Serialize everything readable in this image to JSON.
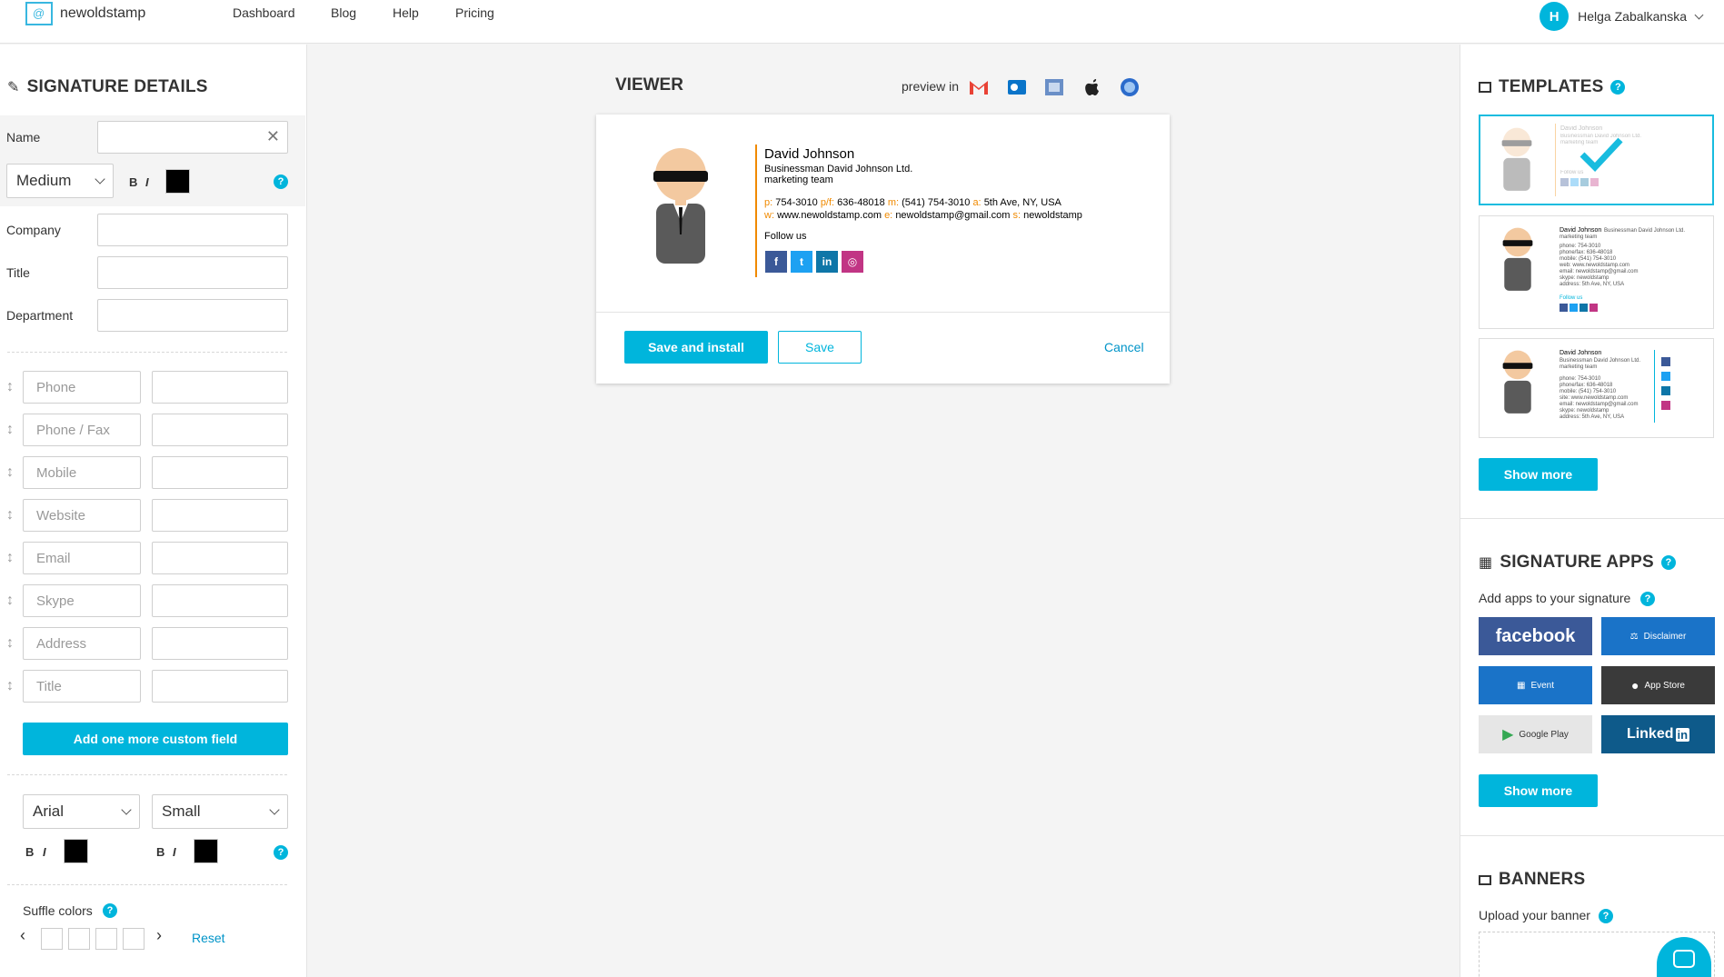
{
  "nav": {
    "logo_text": "newoldstamp",
    "links": [
      "Dashboard",
      "Blog",
      "Help",
      "Pricing"
    ],
    "user_initial": "H",
    "user_name": "Helga Zabalkanska"
  },
  "details": {
    "title": "SIGNATURE DETAILS",
    "name_label": "Name",
    "font_weight": "Medium",
    "bold": "B",
    "italic": "I",
    "company_label": "Company",
    "title_label": "Title",
    "department_label": "Department",
    "custom_fields": [
      "Phone",
      "Phone / Fax",
      "Mobile",
      "Website",
      "Email",
      "Skype",
      "Address",
      "Title"
    ],
    "add_field_button": "Add one more custom field",
    "font_family": "Arial",
    "font_size": "Small",
    "shuffle_label": "Suffle colors",
    "reset": "Reset",
    "help": "?"
  },
  "viewer": {
    "title": "VIEWER",
    "preview_in": "preview in",
    "signature": {
      "name": "David Johnson",
      "position_company": "Businessman  David Johnson Ltd.",
      "department": "marketing team",
      "p_label": "p:",
      "phone": "754-3010",
      "pf_label": "p/f:",
      "phone_fax": "636-48018",
      "m_label": "m:",
      "mobile": "(541) 754-3010",
      "a_label": "a:",
      "address": "5th Ave, NY, USA",
      "w_label": "w:",
      "website": "www.newoldstamp.com",
      "e_label": "e:",
      "email": "newoldstamp@gmail.com",
      "s_label": "s:",
      "skype": "newoldstamp",
      "follow": "Follow us"
    },
    "save_install": "Save and install",
    "save": "Save",
    "cancel": "Cancel"
  },
  "templates": {
    "title": "TEMPLATES",
    "show_more": "Show more",
    "tpl_name": "David Johnson",
    "tpl_company": "Businessman  David Johnson Ltd.",
    "tpl_team": "marketing team",
    "tpl2_lines": [
      "phone: 754-3010",
      "phone/fax: 636-48018",
      "mobile: (541) 754-3010",
      "web: www.newoldstamp.com",
      "email: newoldstamp@gmail.com",
      "skype: newoldstamp",
      "address: 5th Ave, NY, USA"
    ],
    "tpl3_lines": [
      "phone: 754-3010",
      "phone/fax: 636-48018",
      "mobile: (541) 754-3010",
      "site: www.newoldstamp.com",
      "email: newoldstamp@gmail.com",
      "skype: newoldstamp",
      "address: 5th Ave, NY, USA"
    ],
    "follow": "Follow us"
  },
  "apps": {
    "title": "SIGNATURE APPS",
    "subtitle": "Add apps to your signature",
    "items": [
      "facebook",
      "Disclaimer",
      "Event",
      "App Store",
      "Google Play",
      "Linked"
    ],
    "linkedin_in": "in",
    "show_more": "Show more"
  },
  "banners": {
    "title": "BANNERS",
    "subtitle": "Upload your banner"
  },
  "colors": {
    "accent": "#00b5dc",
    "orange": "#f08a00",
    "facebook": "#3b5998",
    "linkedin": "#0e5a8a"
  }
}
